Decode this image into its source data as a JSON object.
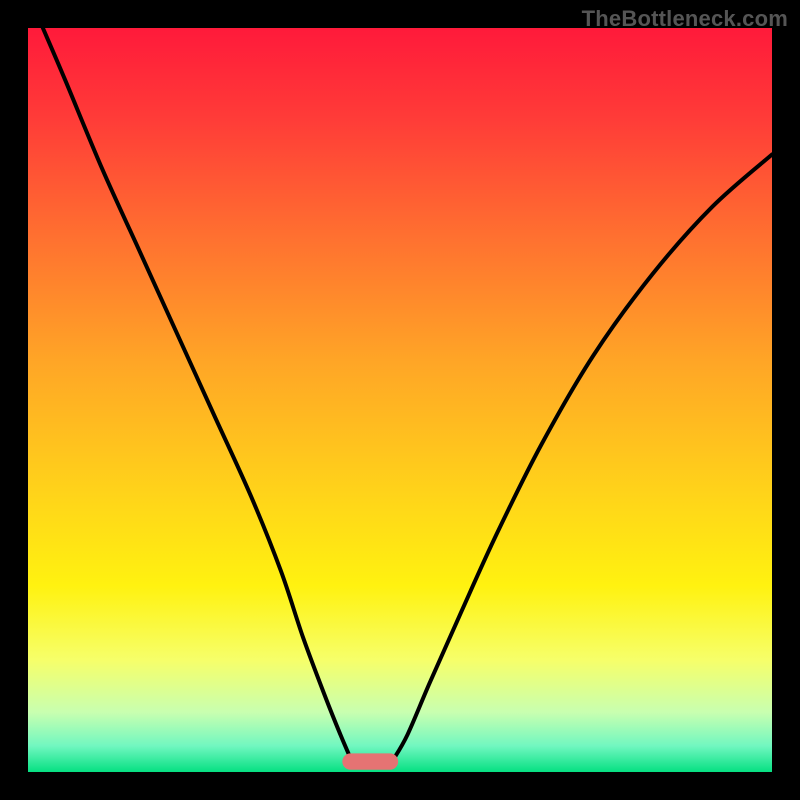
{
  "watermark": "TheBottleneck.com",
  "chart_data": {
    "type": "line",
    "title": "",
    "xlabel": "",
    "ylabel": "",
    "xlim": [
      0,
      100
    ],
    "ylim": [
      0,
      100
    ],
    "gradient_stops": [
      {
        "offset": 0.0,
        "color": "#ff1a3a"
      },
      {
        "offset": 0.12,
        "color": "#ff3b38"
      },
      {
        "offset": 0.28,
        "color": "#ff7030"
      },
      {
        "offset": 0.45,
        "color": "#ffa626"
      },
      {
        "offset": 0.62,
        "color": "#ffd21a"
      },
      {
        "offset": 0.75,
        "color": "#fff210"
      },
      {
        "offset": 0.85,
        "color": "#f6ff6a"
      },
      {
        "offset": 0.92,
        "color": "#c8ffb0"
      },
      {
        "offset": 0.965,
        "color": "#71f7c0"
      },
      {
        "offset": 1.0,
        "color": "#06e082"
      }
    ],
    "series": [
      {
        "name": "left-curve",
        "x": [
          2,
          5,
          10,
          15,
          20,
          25,
          30,
          34,
          37,
          40,
          42,
          43.5
        ],
        "y": [
          100,
          93,
          81,
          70,
          59,
          48,
          37,
          27,
          18,
          10,
          5,
          1.5
        ]
      },
      {
        "name": "right-curve",
        "x": [
          49,
          51,
          54,
          58,
          63,
          69,
          76,
          84,
          92,
          100
        ],
        "y": [
          1.5,
          5,
          12,
          21,
          32,
          44,
          56,
          67,
          76,
          83
        ]
      }
    ],
    "marker": {
      "x_center": 46,
      "width": 7.5,
      "y": 1.4,
      "height": 2.2,
      "color": "#e57373",
      "rx": 1.1
    }
  }
}
